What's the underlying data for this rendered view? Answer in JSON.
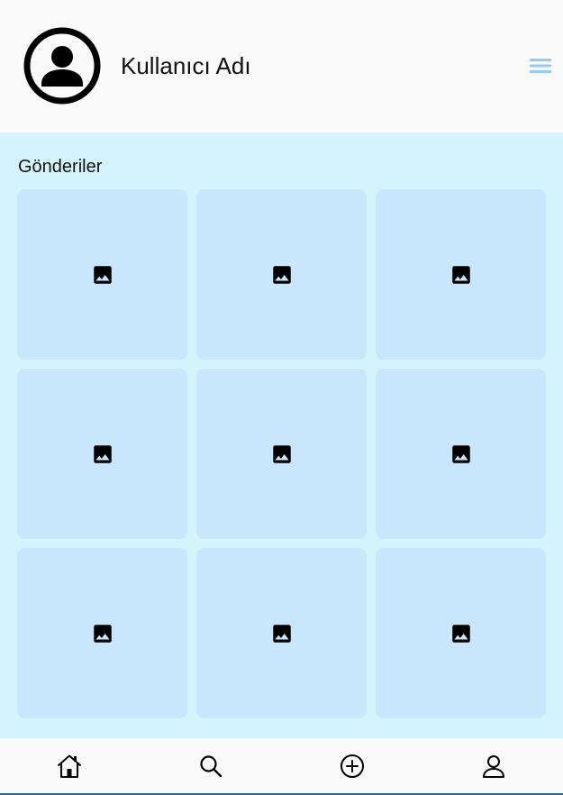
{
  "header": {
    "username": "Kullanıcı Adı",
    "avatar_icon": "account-circle-icon",
    "menu_icon": "hamburger-menu-icon",
    "menu_color": "#90caf9"
  },
  "posts": {
    "title": "Gönderiler",
    "items": [
      {
        "icon": "image-icon"
      },
      {
        "icon": "image-icon"
      },
      {
        "icon": "image-icon"
      },
      {
        "icon": "image-icon"
      },
      {
        "icon": "image-icon"
      },
      {
        "icon": "image-icon"
      },
      {
        "icon": "image-icon"
      },
      {
        "icon": "image-icon"
      },
      {
        "icon": "image-icon"
      }
    ]
  },
  "bottom_nav": {
    "items": [
      {
        "icon": "home-icon"
      },
      {
        "icon": "search-icon"
      },
      {
        "icon": "add-circle-icon"
      },
      {
        "icon": "profile-icon"
      }
    ],
    "border_color": "#2f5f95"
  },
  "colors": {
    "header_bg": "#fafafa",
    "content_bg": "#d5f3fd",
    "tile_bg": "#c8e6fc"
  }
}
